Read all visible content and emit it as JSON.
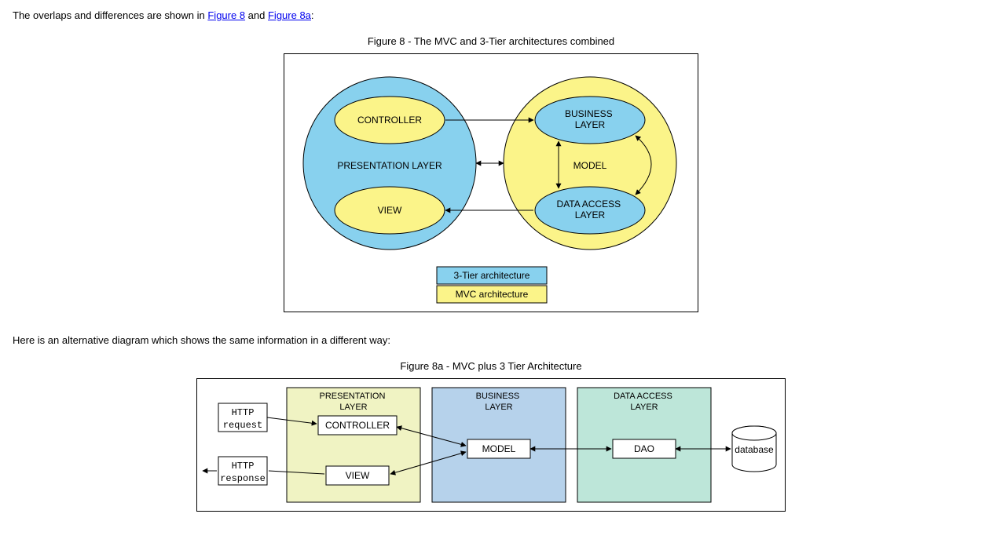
{
  "intro": {
    "prefix": "The overlaps and differences are shown in ",
    "link1": "Figure 8",
    "mid": " and ",
    "link2": "Figure 8a",
    "suffix": ":"
  },
  "fig8": {
    "caption": "Figure 8 - The MVC and 3-Tier architectures combined",
    "left_outer": "PRESENTATION LAYER",
    "left_top": "CONTROLLER",
    "left_bottom": "VIEW",
    "right_outer": "MODEL",
    "right_top": "BUSINESS LAYER",
    "right_bottom": "DATA ACCESS LAYER",
    "legend1": "3-Tier architecture",
    "legend2": "MVC architecture"
  },
  "mid_text": "Here is an alternative diagram which shows the same information in a different way:",
  "fig8a": {
    "caption": "Figure 8a - MVC plus 3 Tier Architecture",
    "http": "HTTP",
    "request": "request",
    "response": "response",
    "pres_layer": "PRESENTATION LAYER",
    "controller": "CONTROLLER",
    "view": "VIEW",
    "bus_layer": "BUSINESS LAYER",
    "model": "MODEL",
    "data_layer": "DATA ACCESS LAYER",
    "dao": "DAO",
    "database": "database"
  },
  "colors": {
    "blue": "#88D1EE",
    "yellow": "#FBF489",
    "blue2": "#B6D2EB",
    "yellow2": "#F0F3C3",
    "teal": "#BDE6D9"
  }
}
